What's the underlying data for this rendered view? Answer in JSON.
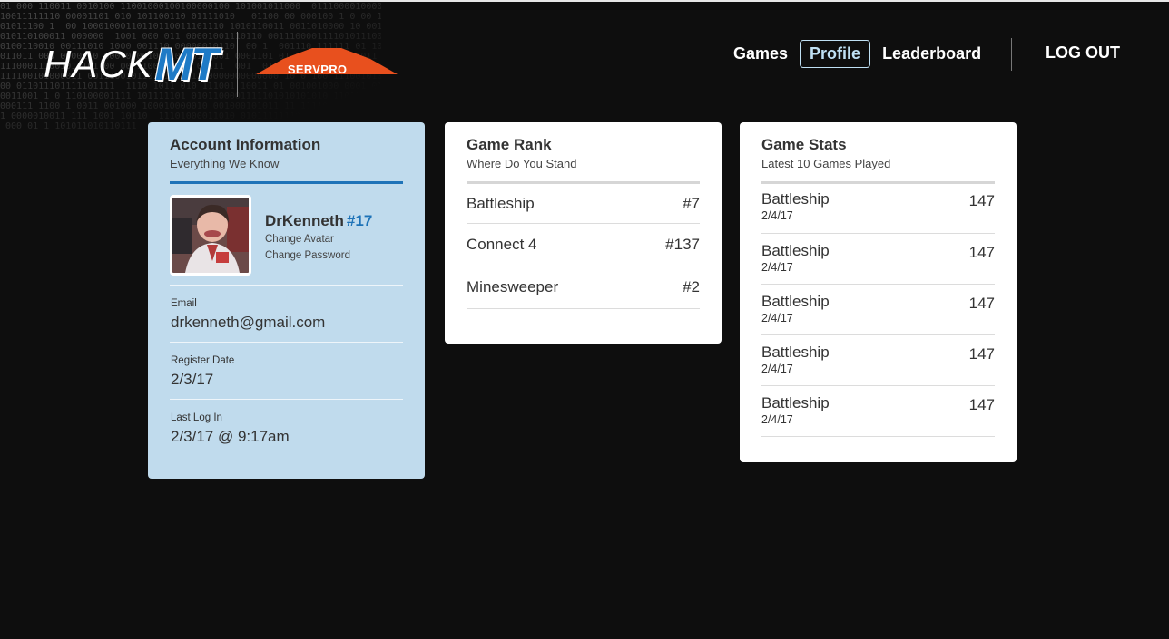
{
  "brand": {
    "hack": "HACK",
    "mt": "MT",
    "sponsor": "SERVPRO",
    "sponsor_color": "#e8501e",
    "mt_color": "#1e7ac6"
  },
  "nav": {
    "items": [
      {
        "label": "Games",
        "active": false
      },
      {
        "label": "Profile",
        "active": true
      },
      {
        "label": "Leaderboard",
        "active": false
      }
    ],
    "logout": "LOG OUT"
  },
  "account": {
    "title": "Account Information",
    "subtitle": "Everything We Know",
    "username": "DrKenneth",
    "rank": "#17",
    "change_avatar": "Change Avatar",
    "change_password": "Change Password",
    "email_label": "Email",
    "email": "drkenneth@gmail.com",
    "register_label": "Register Date",
    "register_date": "2/3/17",
    "last_login_label": "Last Log In",
    "last_login": "2/3/17 @ 9:17am",
    "accent": "#1e73b8",
    "background": "#c0dbed"
  },
  "game_rank": {
    "title": "Game Rank",
    "subtitle": "Where Do You Stand",
    "rows": [
      {
        "game": "Battleship",
        "rank": "#7"
      },
      {
        "game": "Connect 4",
        "rank": "#137"
      },
      {
        "game": "Minesweeper",
        "rank": "#2"
      }
    ]
  },
  "game_stats": {
    "title": "Game Stats",
    "subtitle": "Latest 10 Games Played",
    "rows": [
      {
        "game": "Battleship",
        "date": "2/4/17",
        "score": "147"
      },
      {
        "game": "Battleship",
        "date": "2/4/17",
        "score": "147"
      },
      {
        "game": "Battleship",
        "date": "2/4/17",
        "score": "147"
      },
      {
        "game": "Battleship",
        "date": "2/4/17",
        "score": "147"
      },
      {
        "game": "Battleship",
        "date": "2/4/17",
        "score": "147"
      }
    ]
  }
}
